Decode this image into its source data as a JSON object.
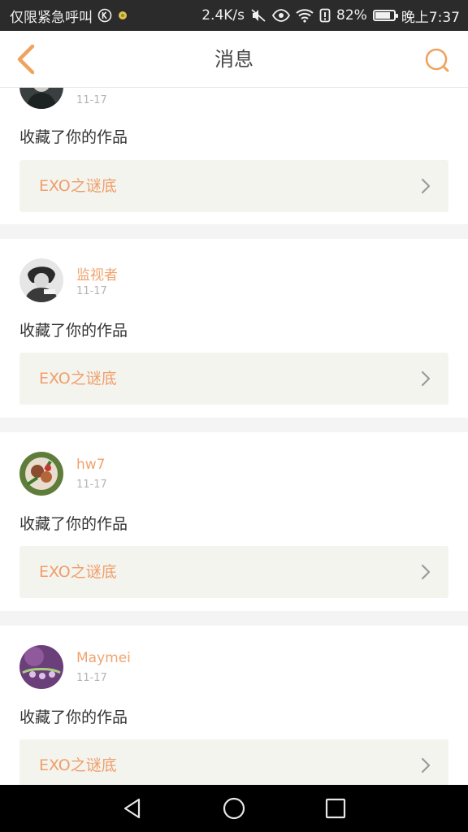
{
  "status_bar": {
    "left_text": "仅限紧急呼叫",
    "network_speed": "2.4K/s",
    "battery": "82%",
    "battery_level": 0.82,
    "time": "晚上7:37",
    "icons": [
      "k-circle-icon",
      "notification-dot-icon",
      "mute-icon",
      "eye-icon",
      "wifi-icon",
      "alarm-icon",
      "battery-icon"
    ]
  },
  "header": {
    "title": "消息",
    "back_icon": "chevron-left-icon",
    "search_icon": "search-icon",
    "accent_color": "#f0a35e"
  },
  "messages": [
    {
      "username": "",
      "time": "11-17",
      "action": "收藏了你的作品",
      "work_title": "EXO之谜底",
      "avatar": "dark-portrait-avatar"
    },
    {
      "username": "监视者",
      "time": "11-17",
      "action": "收藏了你的作品",
      "work_title": "EXO之谜底",
      "avatar": "grayscale-portrait-avatar"
    },
    {
      "username": "hw7",
      "time": "11-17",
      "action": "收藏了你的作品",
      "work_title": "EXO之谜底",
      "avatar": "food-plate-avatar"
    },
    {
      "username": "Maymei",
      "time": "11-17",
      "action": "收藏了你的作品",
      "work_title": "EXO之谜底",
      "avatar": "purple-droplet-avatar"
    }
  ],
  "nav_bar": {
    "icons": [
      "back-triangle-icon",
      "home-circle-icon",
      "recents-square-icon"
    ]
  }
}
